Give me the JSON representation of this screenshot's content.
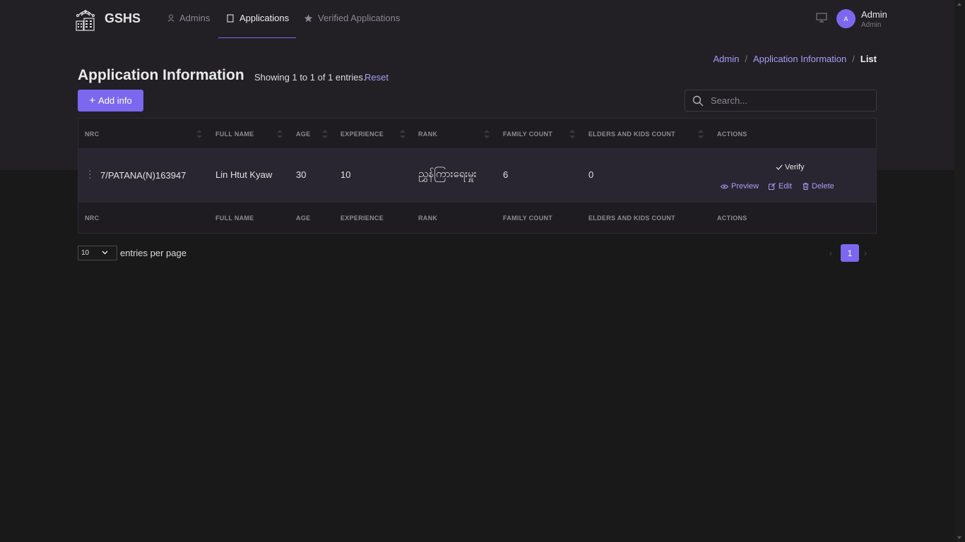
{
  "nav": {
    "brand": "GSHS",
    "items": [
      {
        "label": "Admins",
        "icon": "user-icon"
      },
      {
        "label": "Applications",
        "icon": "document-icon",
        "active": true
      },
      {
        "label": "Verified Applications",
        "icon": "star-icon"
      }
    ],
    "user": {
      "initial": "A",
      "name": "Admin",
      "role": "Admin"
    }
  },
  "breadcrumb": [
    "Admin",
    "Application Information",
    "List"
  ],
  "page": {
    "title": "Application Information",
    "showing": "Showing 1 to 1 of 1 entries.",
    "reset": "Reset",
    "add_button": "Add info",
    "search_placeholder": "Search..."
  },
  "table": {
    "columns": [
      "NRC",
      "FULL NAME",
      "AGE",
      "EXPERIENCE",
      "RANK",
      "FAMILY COUNT",
      "ELDERS AND KIDS COUNT",
      "ACTIONS"
    ],
    "rows": [
      {
        "nrc": "7/PATANA(N)163947",
        "full_name": "Lin Htut Kyaw",
        "age": "30",
        "experience": "10",
        "rank": "ညွှန်ကြားရေးမှူး",
        "family_count": "6",
        "elders_kids_count": "0",
        "actions": {
          "verify": "Verify",
          "preview": "Preview",
          "edit": "Edit",
          "delete": "Delete"
        }
      }
    ]
  },
  "pagination": {
    "per_page": "10",
    "per_page_label": "entries per page",
    "current_page": "1"
  },
  "colors": {
    "accent": "#7b68ee",
    "link": "#a79df5",
    "background": "#191919",
    "header_band": "#222025"
  }
}
